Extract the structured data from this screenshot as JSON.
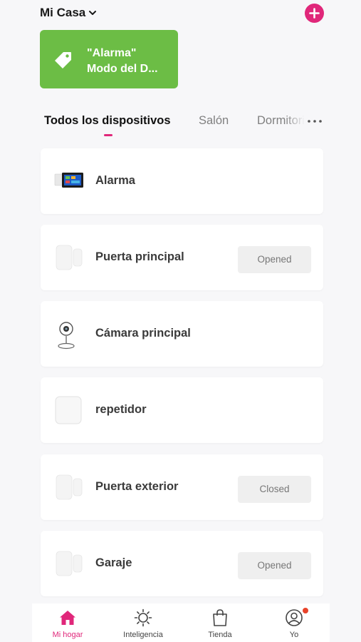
{
  "header": {
    "home_name": "Mi Casa",
    "add_icon": "plus-circle-icon",
    "accent_color": "#e0277a"
  },
  "scene": {
    "line1": "\"Alarma\"",
    "line2": "Modo del D...",
    "icon": "tag-icon",
    "color": "#6cbd45"
  },
  "tabs": [
    {
      "label": "Todos los dispositivos",
      "active": true
    },
    {
      "label": "Salón",
      "active": false
    },
    {
      "label": "Dormitorio",
      "active": false
    }
  ],
  "devices": [
    {
      "name": "Alarma",
      "icon": "alarm-panel-icon",
      "status": ""
    },
    {
      "name": "Puerta principal",
      "icon": "door-sensor-icon",
      "status": "Opened"
    },
    {
      "name": "Cámara principal",
      "icon": "camera-icon",
      "status": ""
    },
    {
      "name": "repetidor",
      "icon": "repeater-icon",
      "status": ""
    },
    {
      "name": "Puerta exterior",
      "icon": "door-sensor-icon",
      "status": "Closed"
    },
    {
      "name": "Garaje",
      "icon": "door-sensor-icon",
      "status": "Opened"
    }
  ],
  "nav": [
    {
      "label": "Mi hogar",
      "icon": "home-icon",
      "active": true
    },
    {
      "label": "Inteligencia",
      "icon": "sun-icon",
      "active": false
    },
    {
      "label": "Tienda",
      "icon": "shopping-bag-icon",
      "active": false
    },
    {
      "label": "Yo",
      "icon": "profile-icon",
      "active": false,
      "badge": true
    }
  ]
}
